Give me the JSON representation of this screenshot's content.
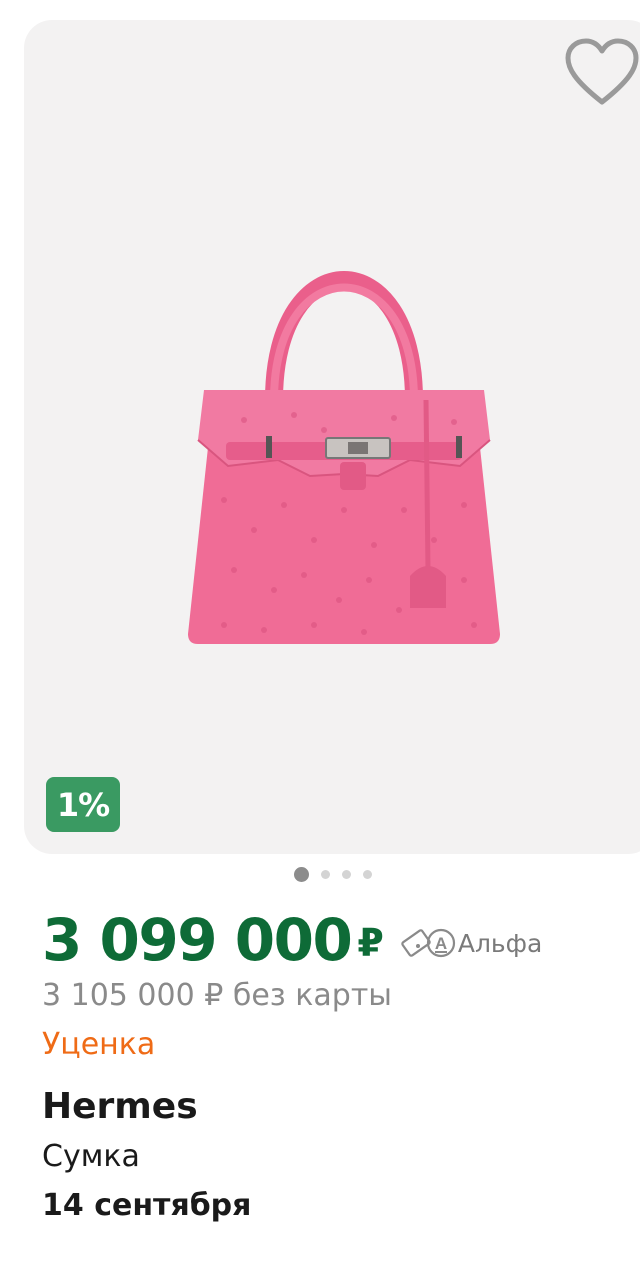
{
  "product": {
    "discount_badge": "1%",
    "price": "3 099 000",
    "currency": "₽",
    "payment_partner": "Альфа",
    "price_without_card": "3 105 000 ₽ без карты",
    "condition_label": "Уценка",
    "brand": "Hermes",
    "type": "Сумка",
    "delivery_date": "14 сентября"
  },
  "gallery": {
    "dots_total": 4,
    "active_dot_index": 0
  },
  "icons": {
    "favorite": "heart-icon",
    "payment": "alfa-card-icon"
  },
  "colors": {
    "price_green": "#0e6b37",
    "badge_green": "#3a9a62",
    "markdown_orange": "#ef6b16",
    "secondary_grey": "#8a8a8a",
    "bag_pink": "#f06c96"
  }
}
